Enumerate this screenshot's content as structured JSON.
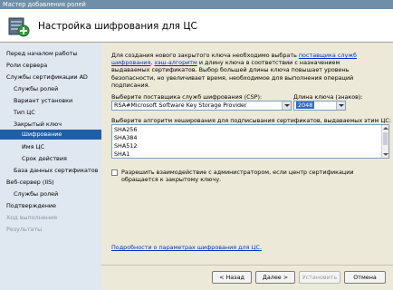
{
  "window": {
    "title": "Мастер добавления ролей"
  },
  "header": {
    "title": "Настройка шифрования для ЦС"
  },
  "sidebar": {
    "items": [
      {
        "label": "Перед началом работы",
        "state": "normal"
      },
      {
        "label": "Роли сервера",
        "state": "normal"
      },
      {
        "label": "Службы сертификации AD",
        "state": "normal"
      },
      {
        "label": "Службы ролей",
        "state": "normal"
      },
      {
        "label": "Вариант установки",
        "state": "normal"
      },
      {
        "label": "Тип ЦС",
        "state": "normal"
      },
      {
        "label": "Закрытый ключ",
        "state": "normal"
      },
      {
        "label": "Шифрование",
        "state": "selected"
      },
      {
        "label": "Имя ЦС",
        "state": "normal"
      },
      {
        "label": "Срок действия",
        "state": "normal"
      },
      {
        "label": "База данных сертификатов",
        "state": "normal"
      },
      {
        "label": "Веб-сервер (IIS)",
        "state": "normal"
      },
      {
        "label": "Службы ролей",
        "state": "normal"
      },
      {
        "label": "Подтверждение",
        "state": "normal"
      },
      {
        "label": "Ход выполнения",
        "state": "disabled"
      },
      {
        "label": "Результаты",
        "state": "disabled"
      }
    ]
  },
  "content": {
    "intro_part1": "Для создания нового закрытого ключа необходимо выбрать ",
    "intro_link1": "поставщика служб шифрования",
    "intro_part2": ", ",
    "intro_link2": "хэш-алгоритм",
    "intro_part3": " и длину ключа в соответствии с назначением выдаваемых сертификатов. Выбор большей длины ключа повышает уровень безопасности, но увеличивает время, необходимое для выполнения операций подписания.",
    "csp_label": "Выберите поставщика служб шифрования (CSP):",
    "csp_value": "RSA#Microsoft Software Key Storage Provider",
    "keylen_label": "Длина ключа (знаков):",
    "keylen_value": "2048",
    "hash_label": "Выберите алгоритм хеширования для подписывания сертификатов, выдаваемых этим ЦС:",
    "hash_options": [
      "SHA256",
      "SHA384",
      "SHA512",
      "SHA1"
    ],
    "checkbox_label": "Разрешить взаимодействие с администратором, если центр сертификации обращается к закрытому ключу.",
    "checkbox_checked": false,
    "bottom_link": "Подробности о параметрах шифрования для ЦС."
  },
  "footer": {
    "back": "< Назад",
    "next": "Далее >",
    "install": "Установить",
    "cancel": "Отмена"
  }
}
